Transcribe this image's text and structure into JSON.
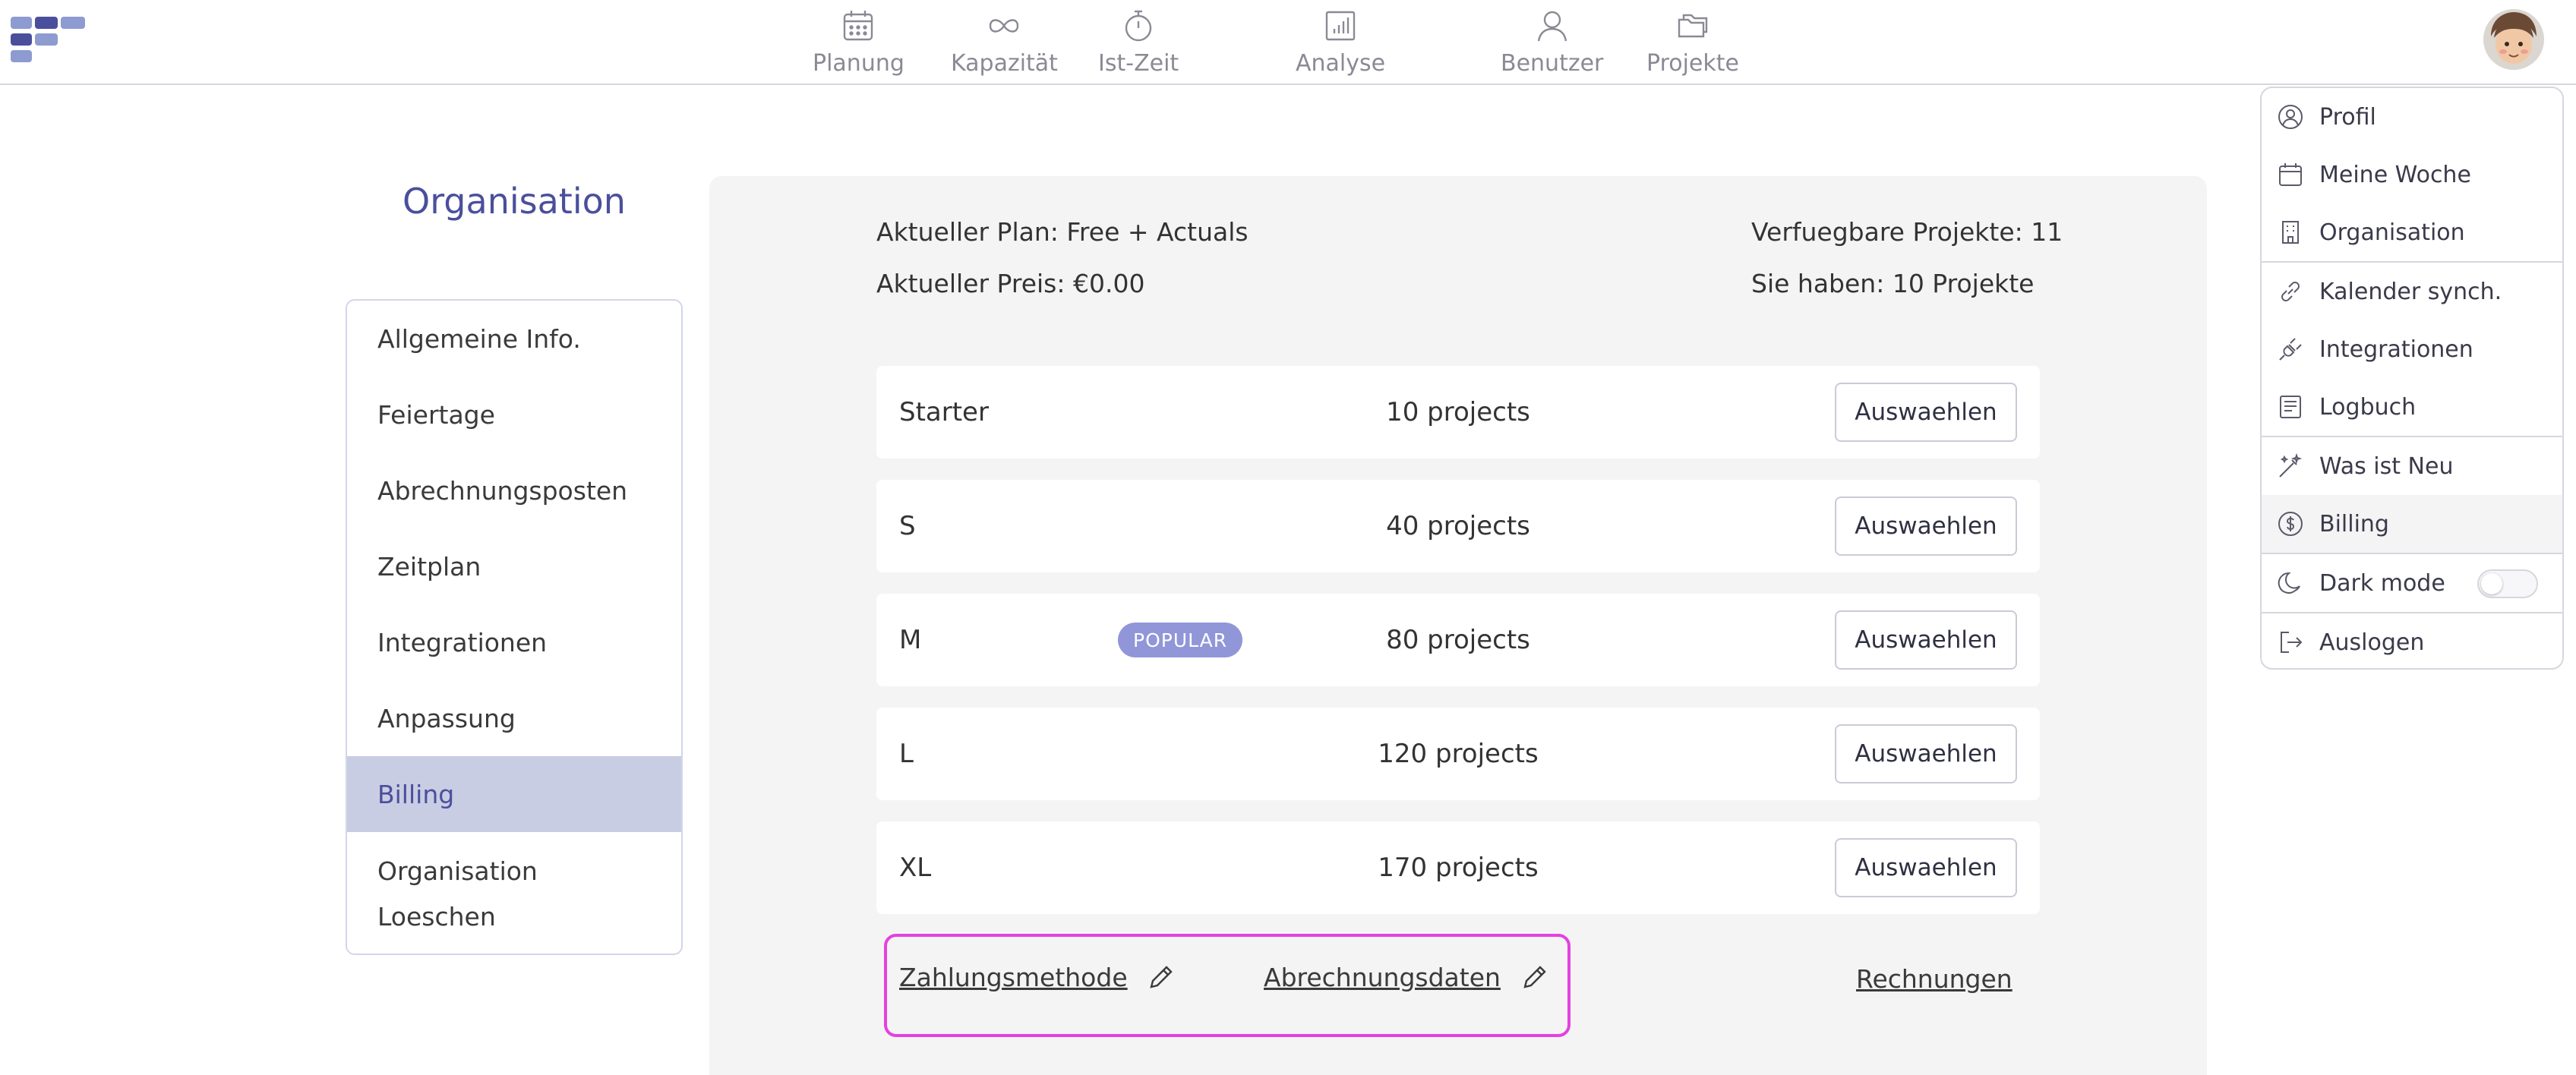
{
  "nav": {
    "items": [
      {
        "label": "Planung",
        "icon": "calendar-icon"
      },
      {
        "label": "Kapazität",
        "icon": "infinity-icon"
      },
      {
        "label": "Ist-Zeit",
        "icon": "stopwatch-icon"
      },
      {
        "label": "Analyse",
        "icon": "bar-chart-icon"
      },
      {
        "label": "Benutzer",
        "icon": "user-icon"
      },
      {
        "label": "Projekte",
        "icon": "folders-icon"
      }
    ]
  },
  "sidebar": {
    "title": "Organisation",
    "items": [
      {
        "label": "Allgemeine Info."
      },
      {
        "label": "Feiertage"
      },
      {
        "label": "Abrechnungsposten"
      },
      {
        "label": "Zeitplan"
      },
      {
        "label": "Integrationen"
      },
      {
        "label": "Anpassung"
      },
      {
        "label": "Billing",
        "active": true
      },
      {
        "label": "Organisation Loeschen"
      }
    ]
  },
  "billing": {
    "current_plan": "Aktueller Plan: Free + Actuals",
    "current_price": "Aktueller Preis: €0.00",
    "available_projects": "Verfuegbare Projekte: 11",
    "your_projects": "Sie haben: 10 Projekte",
    "plans": [
      {
        "name": "Starter",
        "projects": "10 projects",
        "button": "Auswaehlen"
      },
      {
        "name": "S",
        "projects": "40 projects",
        "button": "Auswaehlen"
      },
      {
        "name": "M",
        "badge": "POPULAR",
        "projects": "80 projects",
        "button": "Auswaehlen"
      },
      {
        "name": "L",
        "projects": "120 projects",
        "button": "Auswaehlen"
      },
      {
        "name": "XL",
        "projects": "170 projects",
        "button": "Auswaehlen"
      }
    ],
    "payment_method": "Zahlungsmethode",
    "billing_data": "Abrechnungsdaten",
    "invoices": "Rechnungen"
  },
  "menu": {
    "items": [
      {
        "label": "Profil",
        "icon": "user-circle-icon"
      },
      {
        "label": "Meine Woche",
        "icon": "calendar-icon"
      },
      {
        "label": "Organisation",
        "icon": "building-icon"
      },
      {
        "label": "Kalender synch.",
        "icon": "link-icon"
      },
      {
        "label": "Integrationen",
        "icon": "plug-icon"
      },
      {
        "label": "Logbuch",
        "icon": "log-icon"
      },
      {
        "label": "Was ist Neu",
        "icon": "magic-wand-icon"
      },
      {
        "label": "Billing",
        "icon": "dollar-circle-icon",
        "active": true
      },
      {
        "label": "Dark mode",
        "icon": "moon-icon"
      },
      {
        "label": "Auslogen",
        "icon": "logout-icon"
      }
    ]
  },
  "colors": {
    "accent": "#4a4f9c",
    "active_bg": "#c9cde3",
    "badge": "#9096d8",
    "highlight_border": "#e441e0"
  }
}
